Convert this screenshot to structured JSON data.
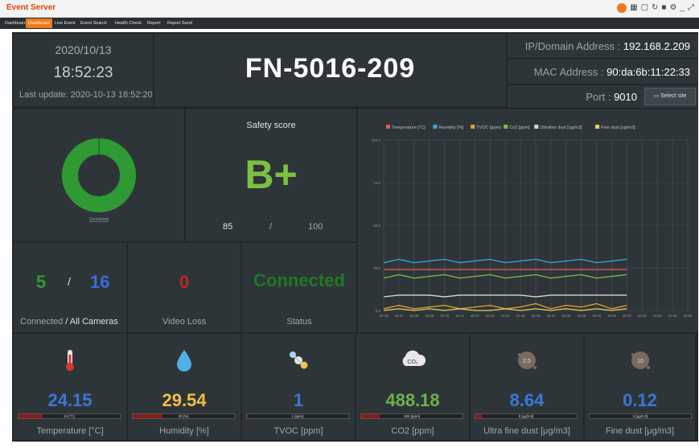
{
  "app": {
    "title": "Event Server"
  },
  "tabs": [
    "Dashboard",
    "Dashboard",
    "Live Event",
    "Event Search",
    "Health Check",
    "Report",
    "Report Send"
  ],
  "active_tab_index": 1,
  "clock": {
    "date": "2020/10/13",
    "time": "18:52:23",
    "last_update": "Last update: 2020-10-13 18:52:20"
  },
  "device": {
    "name": "FN-5016-209"
  },
  "network": {
    "ip_label": "IP/Domain Address",
    "ip_value": "192.168.2.209",
    "mac_label": "MAC Address",
    "mac_value": "90:da:6b:11:22:33",
    "port_label": "Port",
    "port_value": "9010",
    "select_site": "Select site",
    "sep": ":"
  },
  "donut": {
    "label": "Connected",
    "connected_fraction": 1.0,
    "color": "#2f9a33"
  },
  "safety": {
    "title": "Safety score",
    "grade": "B+",
    "score": "85",
    "sep": "/",
    "max": "100",
    "color": "#7cc142"
  },
  "cameras": {
    "connected": "5",
    "sep": "/",
    "total": "16",
    "label_connected": "Connected",
    "label_all": "/ All Cameras"
  },
  "video_loss": {
    "value": "0",
    "label": "Video Loss"
  },
  "status": {
    "value": "Connected",
    "label": "Status"
  },
  "sensors": [
    {
      "key": "temperature",
      "value": "24.15",
      "label": "Temperature [°C]",
      "bar_text": "24 [°C]",
      "level": 0.24,
      "color": "#3a78d8",
      "icon": "thermometer-icon"
    },
    {
      "key": "humidity",
      "value": "29.54",
      "label": "Humidity [%]",
      "bar_text": "29 [%]",
      "level": 0.29,
      "color": "#f0c040",
      "icon": "water-drop-icon"
    },
    {
      "key": "tvoc",
      "value": "1",
      "label": "TVOC [ppm]",
      "bar_text": "1 [ppm]",
      "level": 0.01,
      "color": "#3a78d8",
      "icon": "molecule-icon"
    },
    {
      "key": "co2",
      "value": "488.18",
      "label": "CO2 [ppm]",
      "bar_text": "488 [ppm]",
      "level": 0.18,
      "color": "#6fb24a",
      "icon": "co2-cloud-icon"
    },
    {
      "key": "ultra_fine_dust",
      "value": "8.64",
      "label": "Ultra fine dust [μg/m3]",
      "bar_text": "8 [μg/m3]",
      "level": 0.06,
      "color": "#3a78d8",
      "icon": "dust-2.5-icon"
    },
    {
      "key": "fine_dust",
      "value": "0.12",
      "label": "Fine dust [μg/m3]",
      "bar_text": "0 [μg/m3]",
      "level": 0.0,
      "color": "#3a78d8",
      "icon": "dust-10-icon"
    }
  ],
  "chart_data": {
    "type": "line",
    "legend_position": "top",
    "grid": true,
    "ylim": [
      0,
      100
    ],
    "y_ticks": [
      "0.0",
      "25.0",
      "50.0",
      "75.0",
      "100.0"
    ],
    "x": [
      "18:36",
      "18:37",
      "18:38",
      "18:39",
      "18:40",
      "18:41",
      "18:42",
      "18:43",
      "18:44",
      "18:45",
      "18:46",
      "18:47",
      "18:48",
      "18:49",
      "18:50",
      "18:51",
      "18:52",
      "18:53",
      "18:54",
      "18:55",
      "18:56"
    ],
    "series": [
      {
        "name": "Temperature [°C]",
        "color": "#e05a5a",
        "values": [
          24,
          24,
          24,
          24,
          24,
          24,
          24,
          24,
          24,
          24,
          24,
          24,
          24,
          24,
          24,
          24,
          24
        ]
      },
      {
        "name": "Humidity [%]",
        "color": "#39a9e0",
        "values": [
          28,
          30,
          28,
          29,
          30,
          28,
          29,
          30,
          28,
          29,
          30,
          28,
          29,
          30,
          28,
          29,
          30
        ]
      },
      {
        "name": "TVOC [ppm]",
        "color": "#f0a030",
        "values": [
          1,
          3,
          1,
          2,
          3,
          1,
          2,
          3,
          1,
          2,
          4,
          1,
          3,
          2,
          4,
          1,
          3
        ]
      },
      {
        "name": "Co2 [ppm]",
        "color": "#7cc142",
        "values": [
          19,
          21,
          19,
          20,
          21,
          19,
          20,
          21,
          19,
          20,
          21,
          19,
          20,
          21,
          19,
          20,
          21
        ]
      },
      {
        "name": "Ultrafine dust [ug/m3]",
        "color": "#d8d8d8",
        "values": [
          8,
          9,
          9,
          9,
          8,
          9,
          9,
          9,
          9,
          9,
          8,
          9,
          9,
          9,
          9,
          9,
          9
        ]
      },
      {
        "name": "Fine dust [ug/m3]",
        "color": "#e8d060",
        "values": [
          0,
          1,
          0,
          1,
          0,
          1,
          0,
          0,
          1,
          0,
          1,
          0,
          1,
          0,
          1,
          0,
          1
        ]
      }
    ]
  }
}
